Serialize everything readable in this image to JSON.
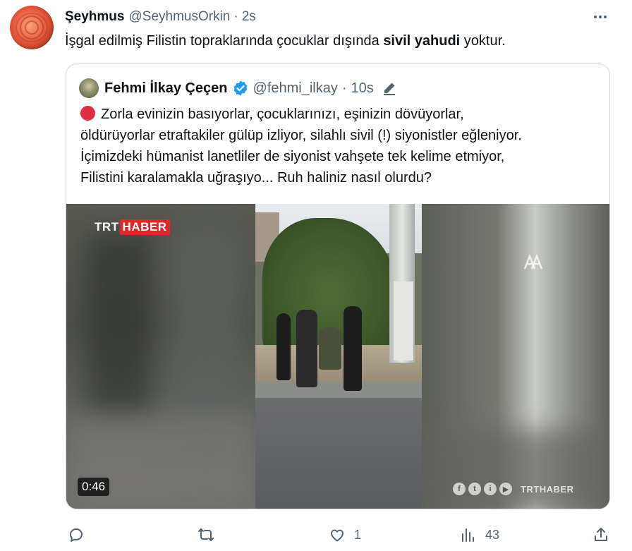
{
  "tweet": {
    "author_name": "Şeyhmus",
    "author_handle": "@SeyhmusOrkin",
    "separator": "·",
    "time": "2s",
    "text_before": "İşgal edilmiş Filistin topraklarında çocuklar dışında ",
    "text_bold": "sivil yahudi",
    "text_after": " yoktur.",
    "more_icon": "more-horizontal-icon"
  },
  "quote": {
    "author_name": "Fehmi İlkay Çeçen",
    "author_handle": "@fehmi_ilkay",
    "separator": "·",
    "time": "10s",
    "verified_icon": "verified-badge-icon",
    "verified_color": "#1d9bf0",
    "edit_icon": "edit-pencil-icon",
    "lines": [
      "Zorla evinizin basıyorlar, çocuklarınızı, eşinizin dövüyorlar,",
      "öldürüyorlar etraftakiler gülüp izliyor, silahlı sivil (!) siyonistler eğleniyor.",
      "İçimizdeki hümanist lanetliler de siyonist vahşete tek kelime etmiyor,",
      "Filistini karalamakla uğraşıyo... Ruh haliniz nasıl olurdu?"
    ],
    "bullet_color": "#dd2e44",
    "media": {
      "logo_trt": "TRT",
      "logo_haber": "HABER",
      "logo_color": "#e3262b",
      "watermark_icon": "anadolu-agency-icon",
      "social_icons": [
        "f",
        "t",
        "i",
        "▶"
      ],
      "social_brand": "TRTHABER",
      "duration": "0:46"
    }
  },
  "actions": {
    "reply": {
      "icon": "reply-icon",
      "count": ""
    },
    "retweet": {
      "icon": "retweet-icon",
      "count": ""
    },
    "like": {
      "icon": "heart-icon",
      "count": "1"
    },
    "views": {
      "icon": "views-chart-icon",
      "count": "43"
    },
    "share": {
      "icon": "share-icon",
      "count": ""
    }
  }
}
